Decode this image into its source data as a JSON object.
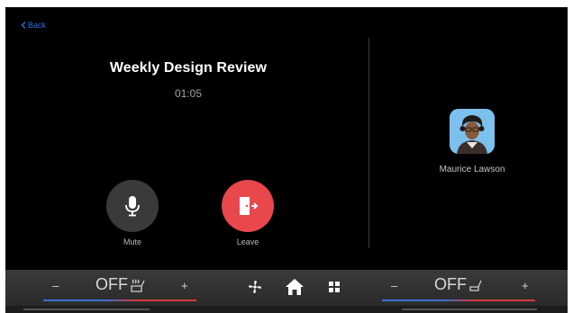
{
  "nav": {
    "back_label": "Back"
  },
  "call": {
    "title": "Weekly Design Review",
    "timer": "01:05"
  },
  "controls": {
    "mute_label": "Mute",
    "leave_label": "Leave"
  },
  "participant": {
    "name": "Maurice Lawson"
  },
  "climate": {
    "left": {
      "minus": "–",
      "value": "OFF",
      "plus": "+"
    },
    "right": {
      "minus": "–",
      "value": "OFF",
      "plus": "+"
    }
  },
  "colors": {
    "accent_blue": "#2f6fe0",
    "leave_red": "#e8474b",
    "background": "#000000"
  },
  "icons": [
    "back-chevron-icon",
    "microphone-icon",
    "leave-door-icon",
    "fan-icon",
    "home-icon",
    "grid-icon",
    "seat-heat-icon",
    "seat-icon"
  ]
}
